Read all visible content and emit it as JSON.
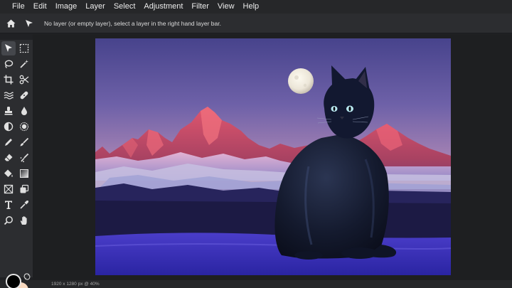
{
  "menubar": {
    "items": [
      "File",
      "Edit",
      "Image",
      "Layer",
      "Select",
      "Adjustment",
      "Filter",
      "View",
      "Help"
    ]
  },
  "options_bar": {
    "home_icon": "home-icon",
    "tool_icon": "pointer-arrow-icon",
    "message": "No layer (or empty layer), select a layer in the right hand layer bar."
  },
  "toolbox": {
    "tools": [
      "move-tool-icon",
      "marquee-select-icon",
      "lasso-icon",
      "magic-wand-icon",
      "crop-icon",
      "scissors-icon",
      "liquify-icon",
      "healing-bandage-icon",
      "clone-stamp-icon",
      "drop-blur-icon",
      "dodge-burn-icon",
      "sponge-icon",
      "pencil-icon",
      "brush-icon",
      "eraser-icon",
      "smudge-icon",
      "paint-bucket-icon",
      "gradient-icon",
      "shape-icon",
      "layers-icon",
      "text-tool-icon",
      "eyedropper-icon",
      "zoom-icon",
      "hand-icon"
    ],
    "active_tool": "move-tool-icon",
    "foreground_color": "#000000",
    "background_color": "#f8d9bf"
  },
  "status": {
    "zoom_text": "1920 x 1280 px @ 40%"
  }
}
